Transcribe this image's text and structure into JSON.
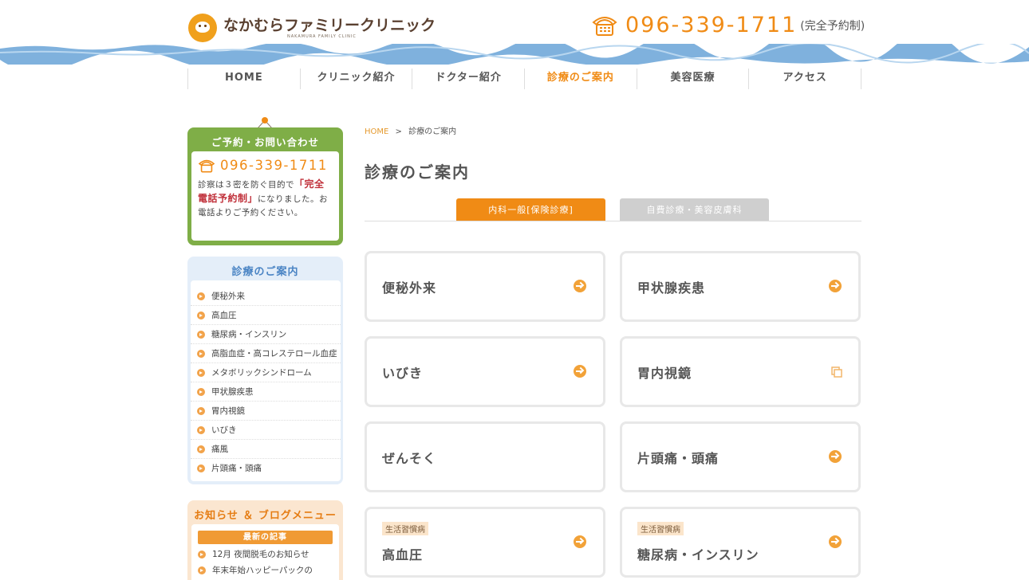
{
  "header": {
    "logo_name": "なかむらファミリークリニック",
    "logo_sub": "NAKAMURA FAMILY CLINIC",
    "tel": "096-339-1711",
    "tel_note": "(完全予約制)"
  },
  "gnav": [
    {
      "label": "HOME"
    },
    {
      "label": "クリニック紹介"
    },
    {
      "label": "ドクター紹介"
    },
    {
      "label": "診療のご案内",
      "active": true
    },
    {
      "label": "美容医療"
    },
    {
      "label": "アクセス"
    }
  ],
  "sidebar": {
    "contact_title": "ご予約・お問い合わせ",
    "contact_tel": "096-339-1711",
    "contact_text_1": "診察は３密を防ぐ目的で",
    "contact_text_strong": "「完全電話予約制」",
    "contact_text_2": "になりました。お電話よりご予約ください。",
    "menu_title": "診療のご案内",
    "menu_items": [
      "便秘外来",
      "高血圧",
      "糖尿病・インスリン",
      "高脂血症・高コレステロール血症",
      "メタボリックシンドローム",
      "甲状腺疾患",
      "胃内視鏡",
      "いびき",
      "痛風",
      "片頭痛・頭痛"
    ],
    "blog_title": "お知らせ ＆ ブログメニュー",
    "blog_bar": "最新の記事",
    "blog_items": [
      "12月 夜間脱毛のお知らせ",
      "年末年始ハッピーパックの"
    ]
  },
  "main": {
    "breadcrumb_home": "HOME",
    "breadcrumb_sep": ">",
    "breadcrumb_current": "診療のご案内",
    "title": "診療のご案内",
    "tabs": [
      "内科一般[保険診療]",
      "自費診療・美容皮膚科"
    ],
    "cards": [
      {
        "label": "便秘外来",
        "tag": "",
        "icon": "arrow"
      },
      {
        "label": "甲状腺疾患",
        "tag": "",
        "icon": "arrow"
      },
      {
        "label": "いびき",
        "tag": "",
        "icon": "arrow"
      },
      {
        "label": "胃内視鏡",
        "tag": "",
        "icon": "external"
      },
      {
        "label": "ぜんそく",
        "tag": "",
        "icon": "none"
      },
      {
        "label": "片頭痛・頭痛",
        "tag": "",
        "icon": "arrow"
      },
      {
        "label": "高血圧",
        "tag": "生活習慣病",
        "icon": "arrow"
      },
      {
        "label": "糖尿病・インスリン",
        "tag": "生活習慣病",
        "icon": "arrow"
      }
    ]
  },
  "colors": {
    "accent": "#f08b15",
    "green": "#7fae47",
    "blue": "#4a84c4",
    "wave": "#7fb1dd"
  }
}
